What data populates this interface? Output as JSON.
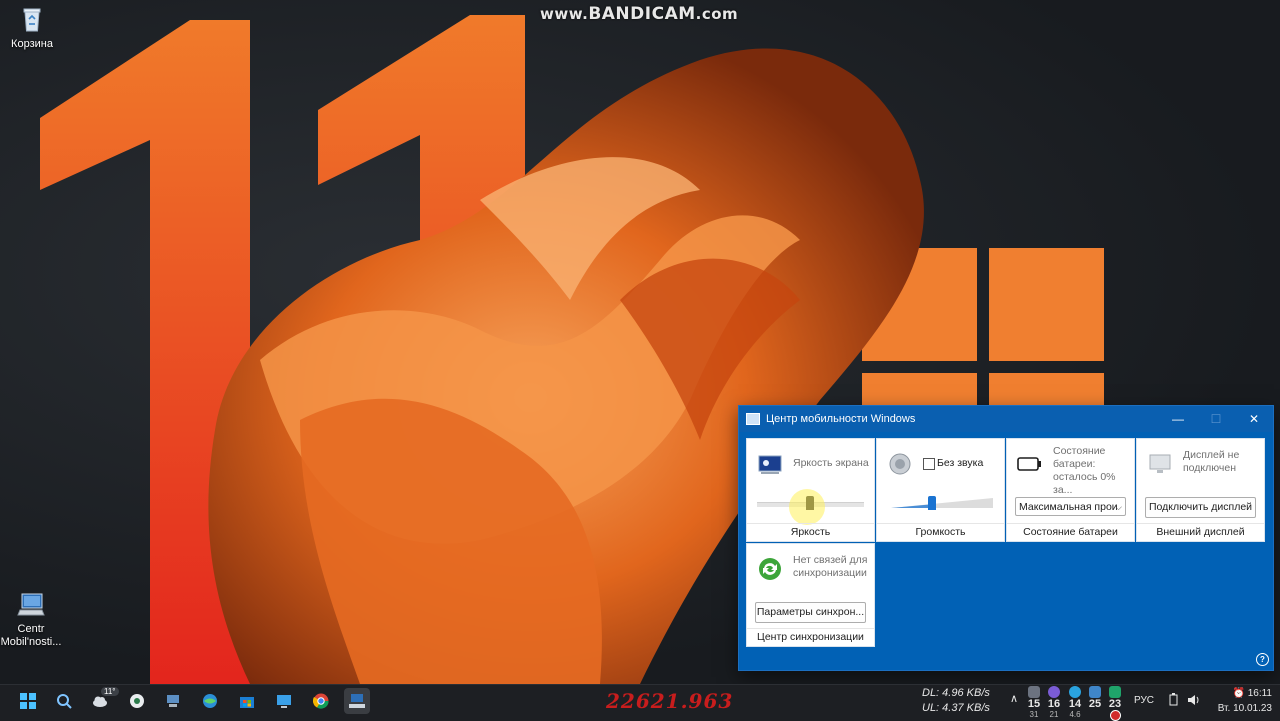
{
  "desktop": {
    "watermark_prefix": "www.",
    "watermark_brand": "BANDICAM",
    "watermark_suffix": ".com",
    "icons": [
      {
        "label": "Корзина",
        "icon": "recycle-bin-icon"
      },
      {
        "label": "Centr Mobil'nosti...",
        "icon": "mobility-center-icon"
      }
    ],
    "accent_colors": {
      "wallpaper_orange": "#f07a2a",
      "wallpaper_red": "#e3251d",
      "window_blue": "#0161b5"
    }
  },
  "window": {
    "title": "Центр мобильности Windows",
    "controls": {
      "minimize": "—",
      "maximize": "☐",
      "close": "✕"
    },
    "help": "?",
    "tiles": {
      "brightness": {
        "label": "Яркость экрана",
        "footer": "Яркость",
        "icon": "display-brightness-icon"
      },
      "volume": {
        "checkbox_label": "Без звука",
        "footer": "Громкость",
        "icon": "speaker-icon",
        "muted": false
      },
      "battery": {
        "label": "Состояние батареи: осталось 0% за...",
        "selected_plan": "Максимальная прои",
        "footer": "Состояние батареи",
        "icon": "battery-icon"
      },
      "display": {
        "label": "Дисплей не подключен",
        "button": "Подключить дисплей",
        "footer": "Внешний дисплей",
        "icon": "external-display-icon"
      },
      "sync": {
        "label": "Нет связей для синхронизации",
        "button": "Параметры синхрон...",
        "footer": "Центр синхронизации",
        "icon": "sync-center-icon"
      }
    }
  },
  "taskbar": {
    "weather_temp": "11°",
    "build_number": "22621.963",
    "network": {
      "dl": "DL: 4.96 KB/s",
      "ul": "UL: 4.37 KB/s"
    },
    "tray_numbers": [
      {
        "top": "15",
        "bottom": "31"
      },
      {
        "top": "16",
        "bottom": "21"
      },
      {
        "top": "14",
        "bottom": "4.6"
      },
      {
        "top": "25",
        "bottom": ""
      },
      {
        "top": "23",
        "bottom": ""
      }
    ],
    "chevron": "∧",
    "language": "РУС",
    "time": "16:11",
    "date": "Вт. 10.01.23"
  }
}
